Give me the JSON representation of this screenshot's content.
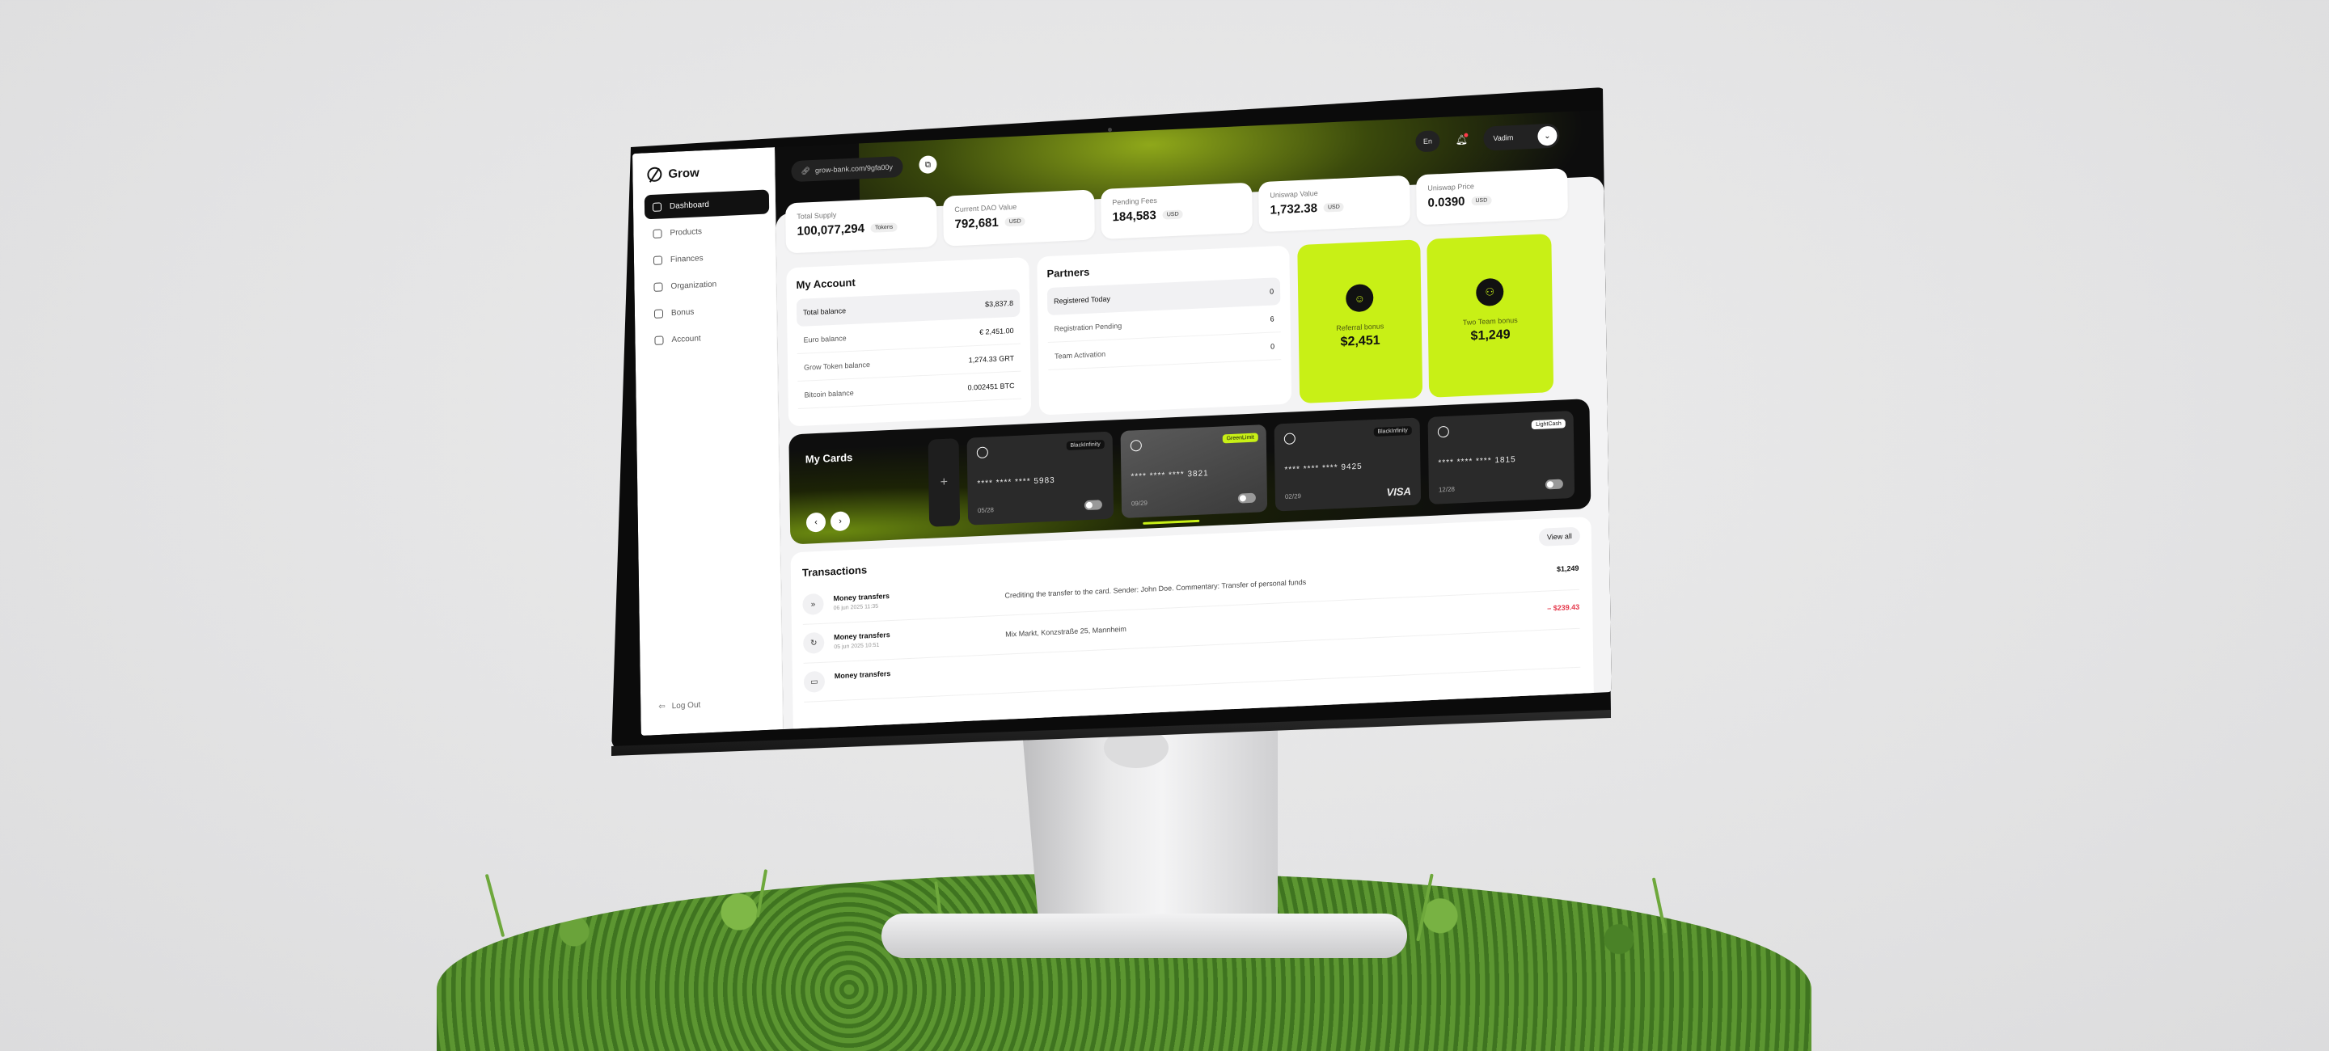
{
  "brand": {
    "name": "Grow",
    "accent": "#c8f016",
    "negative": "#e5384b"
  },
  "sidebar": {
    "items": [
      {
        "label": "Dashboard",
        "icon": "grid-icon",
        "active": true
      },
      {
        "label": "Products",
        "icon": "cart-icon"
      },
      {
        "label": "Finances",
        "icon": "coins-icon"
      },
      {
        "label": "Organization",
        "icon": "org-icon"
      },
      {
        "label": "Bonus",
        "icon": "gift-icon"
      },
      {
        "label": "Account",
        "icon": "gear-icon"
      }
    ],
    "logout": "Log Out"
  },
  "topbar": {
    "link": "grow-bank.com/9gfa00y",
    "lang": "En",
    "user": "Vadim"
  },
  "stats": [
    {
      "label": "Total Supply",
      "value": "100,077,294",
      "unit": "Tokens"
    },
    {
      "label": "Current DAO Value",
      "value": "792,681",
      "unit": "USD"
    },
    {
      "label": "Pending Fees",
      "value": "184,583",
      "unit": "USD"
    },
    {
      "label": "Uniswap Value",
      "value": "1,732.38",
      "unit": "USD"
    },
    {
      "label": "Uniswap Price",
      "value": "0.0390",
      "unit": "USD"
    }
  ],
  "account": {
    "title": "My Account",
    "rows": [
      {
        "label": "Total balance",
        "value": "$3,837.8"
      },
      {
        "label": "Euro balance",
        "value": "€ 2,451.00"
      },
      {
        "label": "Grow Token balance",
        "value": "1,274.33 GRT"
      },
      {
        "label": "Bitcoin balance",
        "value": "0.002451 BTC"
      }
    ]
  },
  "partners": {
    "title": "Partners",
    "rows": [
      {
        "label": "Registered Today",
        "value": "0"
      },
      {
        "label": "Registration Pending",
        "value": "6"
      },
      {
        "label": "Team Activation",
        "value": "0"
      }
    ]
  },
  "bonuses": [
    {
      "label": "Referral bonus",
      "value": "$2,451",
      "icon": "user-icon"
    },
    {
      "label": "Two Team bonus",
      "value": "$1,249",
      "icon": "team-icon"
    }
  ],
  "cards": {
    "title": "My Cards",
    "add": "+",
    "prev": "‹",
    "next": "›",
    "items": [
      {
        "tag": "BlackInfinity",
        "number": "**** **** **** 5983",
        "exp": "05/28",
        "brand": ""
      },
      {
        "tag": "GreenLimit",
        "number": "**** **** **** 3821",
        "exp": "09/29",
        "brand": ""
      },
      {
        "tag": "BlackInfinity",
        "number": "**** **** **** 9425",
        "exp": "02/29",
        "brand": "VISA"
      },
      {
        "tag": "LightCash",
        "number": "**** **** **** 1815",
        "exp": "12/28",
        "brand": ""
      }
    ]
  },
  "transactions": {
    "title": "Transactions",
    "view_all": "View all",
    "rows": [
      {
        "name": "Money transfers",
        "date": "06 jun 2025 11:35",
        "desc": "Crediting the transfer to the card. Sender: John Doe. Commentary: Transfer of personal funds",
        "amount": "$1,249",
        "negative": false,
        "icon": "double-chevron-icon"
      },
      {
        "name": "Money transfers",
        "date": "05 jun 2025 10:51",
        "desc": "Mix Markt, Konzstraße 25, Mannheim",
        "amount": "– $239.43",
        "negative": true,
        "icon": "refresh-icon"
      },
      {
        "name": "Money transfers",
        "date": "",
        "desc": "",
        "amount": "",
        "negative": true,
        "icon": "card-icon"
      }
    ]
  }
}
